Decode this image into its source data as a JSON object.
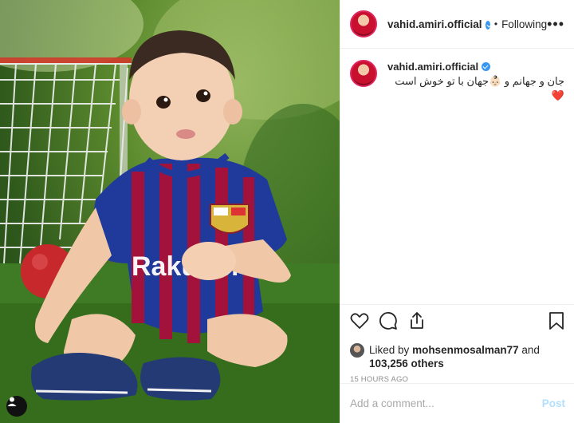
{
  "post": {
    "author": "vahid.amiri.official",
    "follow_state": "Following",
    "separator": "•",
    "more_label": "•••",
    "caption": "جان و جهانم و 👶🏻جهان با تو خوش است❤️",
    "likes_prefix": "Liked by",
    "liked_by_user": "mohsenmosalman77",
    "likes_and": "and",
    "likes_count": "103,256 others",
    "timestamp": "15 HOURS AGO"
  },
  "comment_box": {
    "placeholder": "Add a comment...",
    "post_label": "Post"
  },
  "icons": {
    "like": "heart-icon",
    "comment": "comment-bubble-icon",
    "share": "share-icon",
    "save": "bookmark-icon",
    "tag": "user-tag-icon",
    "verified": "verified-badge-icon"
  },
  "colors": {
    "verified": "#3897f0",
    "post_disabled": "#b2dffc",
    "timestamp": "#8e8e8e",
    "border": "#efefef"
  }
}
